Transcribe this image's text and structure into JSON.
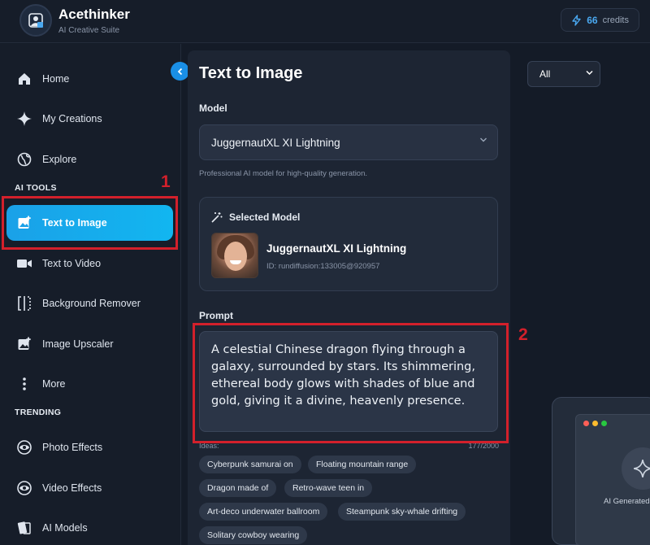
{
  "header": {
    "brand": "Acethinker",
    "tagline": "AI Creative Suite",
    "credits_count": "66",
    "credits_label": "credits"
  },
  "sidebar": {
    "top_items": [
      {
        "label": "Home",
        "icon": "home-icon"
      },
      {
        "label": "My Creations",
        "icon": "sparkle-icon"
      },
      {
        "label": "Explore",
        "icon": "globe-icon"
      }
    ],
    "tools_label": "AI TOOLS",
    "tools": [
      {
        "label": "Text to Image",
        "icon": "image-plus-icon",
        "active": true
      },
      {
        "label": "Text to Video",
        "icon": "video-icon"
      },
      {
        "label": "Background Remover",
        "icon": "background-remover-icon"
      },
      {
        "label": "Image Upscaler",
        "icon": "image-upscale-icon"
      },
      {
        "label": "More",
        "icon": "more-vertical-icon"
      }
    ],
    "trending_label": "TRENDING",
    "trending": [
      {
        "label": "Photo Effects",
        "icon": "photo-effects-icon"
      },
      {
        "label": "Video Effects",
        "icon": "video-effects-icon"
      },
      {
        "label": "AI Models",
        "icon": "models-icon"
      }
    ]
  },
  "annotations": {
    "one": "1",
    "two": "2"
  },
  "main": {
    "title": "Text to Image",
    "model_label": "Model",
    "model_value": "JuggernautXL XI Lightning",
    "model_helper": "Professional AI model for high-quality generation.",
    "selected_heading": "Selected Model",
    "selected_name": "JuggernautXL XI Lightning",
    "selected_id": "ID: rundiffusion:133005@920957",
    "prompt_label": "Prompt",
    "prompt_text": "A celestial Chinese dragon flying through a galaxy, surrounded by stars. Its shimmering, ethereal body glows with shades of blue and gold, giving it a divine, heavenly presence.",
    "ideas_label": "Ideas:",
    "char_counter": "177/2000",
    "ideas": [
      "Cyberpunk samurai on",
      "Floating mountain range",
      "Dragon made of",
      "Retro-wave teen in",
      "Art-deco underwater ballroom",
      "Steampunk sky-whale drifting",
      "Solitary cowboy wearing"
    ]
  },
  "filter": {
    "value": "All"
  },
  "preview": {
    "caption": "AI Generated"
  }
}
